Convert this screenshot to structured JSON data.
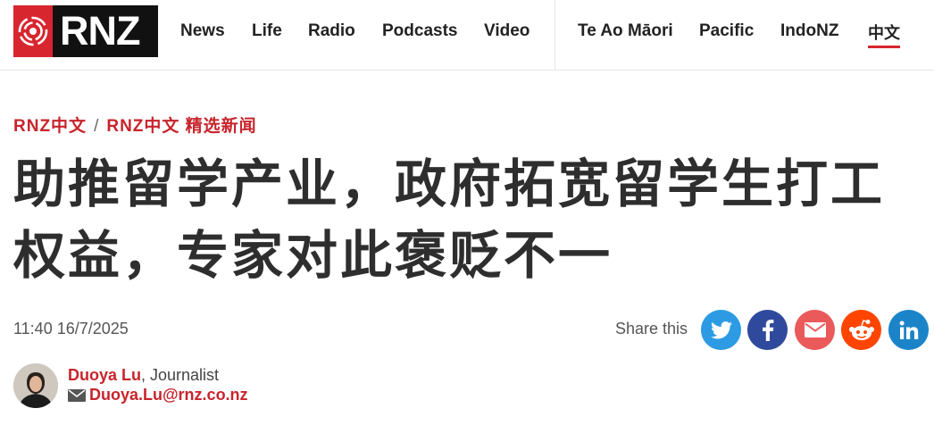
{
  "brand": {
    "name": "RNZ",
    "accent": "#d8262f"
  },
  "nav": {
    "primary": [
      "News",
      "Life",
      "Radio",
      "Podcasts",
      "Video"
    ],
    "secondary": [
      "Te Ao Māori",
      "Pacific",
      "IndoNZ",
      "中文"
    ],
    "active": "中文"
  },
  "breadcrumb": {
    "first": "RNZ中文",
    "separator": "/",
    "second": "RNZ中文 精选新闻"
  },
  "article": {
    "title": "助推留学产业，政府拓宽留学生打工权益，专家对此褒贬不一",
    "timestamp": "11:40 16/7/2025"
  },
  "share": {
    "label": "Share this",
    "buttons": [
      {
        "name": "twitter",
        "icon": "twitter-icon",
        "color": "#2d9be3"
      },
      {
        "name": "facebook",
        "icon": "facebook-icon",
        "color": "#2f4a9c"
      },
      {
        "name": "email",
        "icon": "mail-icon",
        "color": "#ea5a5a"
      },
      {
        "name": "reddit",
        "icon": "reddit-icon",
        "color": "#ff4500"
      },
      {
        "name": "linkedin",
        "icon": "linkedin-icon",
        "color": "#1b84c8"
      }
    ]
  },
  "author": {
    "name": "Duoya Lu",
    "role": ", Journalist",
    "email": "Duoya.Lu@rnz.co.nz"
  }
}
